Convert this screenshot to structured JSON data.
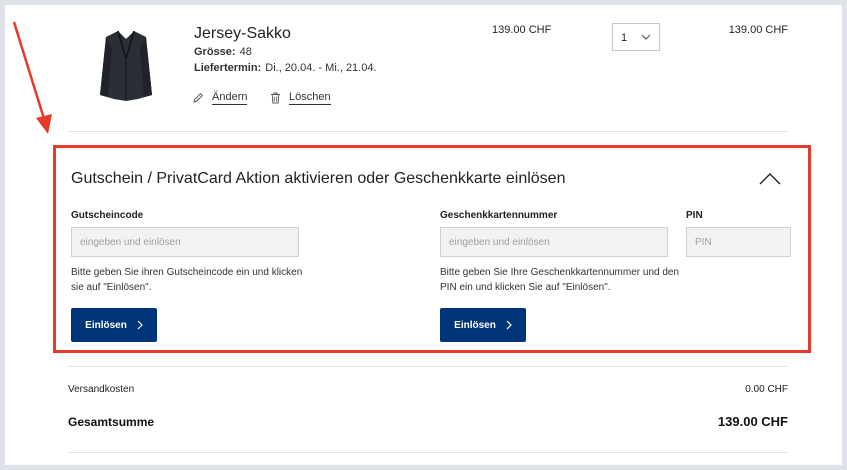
{
  "product": {
    "name": "Jersey-Sakko",
    "size_label": "Grösse:",
    "size_value": "48",
    "delivery_label": "Liefertermin:",
    "delivery_value": "Di., 20.04. - Mi., 21.04.",
    "unit_price": "139.00 CHF",
    "quantity": "1",
    "line_total": "139.00 CHF",
    "edit_label": "Ändern",
    "delete_label": "Löschen"
  },
  "voucher": {
    "title": "Gutschein / PrivatCard Aktion aktivieren oder Geschenkkarte einlösen",
    "coupon_label": "Gutscheincode",
    "coupon_placeholder": "eingeben und einlösen",
    "coupon_help": "Bitte geben Sie ihren Gutscheincode ein und klicken sie auf \"Einlösen\".",
    "giftcard_label": "Geschenkkartennummer",
    "giftcard_placeholder": "eingeben und einlösen",
    "pin_label": "PIN",
    "pin_placeholder": "PIN",
    "giftcard_help": "Bitte geben Sie Ihre Geschenkkartennummer und den PIN ein und klicken Sie auf \"Einlösen\".",
    "redeem_label": "Einlösen",
    "highlight_color": "#e53a2c",
    "button_color": "#003478"
  },
  "summary": {
    "shipping_label": "Versandkosten",
    "shipping_value": "0.00 CHF",
    "total_label": "Gesamtsumme",
    "total_value": "139.00 CHF"
  }
}
